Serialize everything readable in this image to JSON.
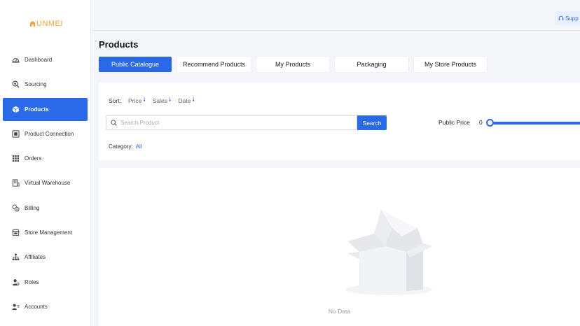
{
  "brand": {
    "logo_text": "UNMEI",
    "accent": "#2a6ae9",
    "logo_color": "#f0a23a"
  },
  "sidebar": {
    "items": [
      {
        "label": "Dashboard",
        "icon": "dashboard-icon"
      },
      {
        "label": "Sourcing",
        "icon": "sourcing-search-icon"
      },
      {
        "label": "Products",
        "icon": "box-icon",
        "active": true
      },
      {
        "label": "Product Connection",
        "icon": "connection-icon"
      },
      {
        "label": "Orders",
        "icon": "grid-icon"
      },
      {
        "label": "Virtual Warehouse",
        "icon": "warehouse-icon"
      },
      {
        "label": "Billing",
        "icon": "billing-icon"
      },
      {
        "label": "Store Management",
        "icon": "store-icon"
      },
      {
        "label": "Affiliates",
        "icon": "affiliates-icon"
      },
      {
        "label": "Roles",
        "icon": "roles-icon"
      },
      {
        "label": "Accounts",
        "icon": "accounts-icon"
      }
    ]
  },
  "topbar": {
    "support_label": "Supp"
  },
  "main": {
    "title": "Products",
    "tabs": [
      {
        "label": "Public Catalogue",
        "active": true
      },
      {
        "label": "Recommend Products"
      },
      {
        "label": "My Products"
      },
      {
        "label": "Packaging"
      },
      {
        "label": "My Store Products"
      }
    ],
    "filters": {
      "sort_label": "Sort:",
      "sort_options": [
        "Price",
        "Sales",
        "Date"
      ],
      "search_placeholder": "Search Product",
      "search_value": "",
      "search_button": "Search",
      "price_label": "Public Price",
      "price_min": "0",
      "category_label": "Category:",
      "category_value": "All"
    },
    "empty_text": "No Data"
  }
}
